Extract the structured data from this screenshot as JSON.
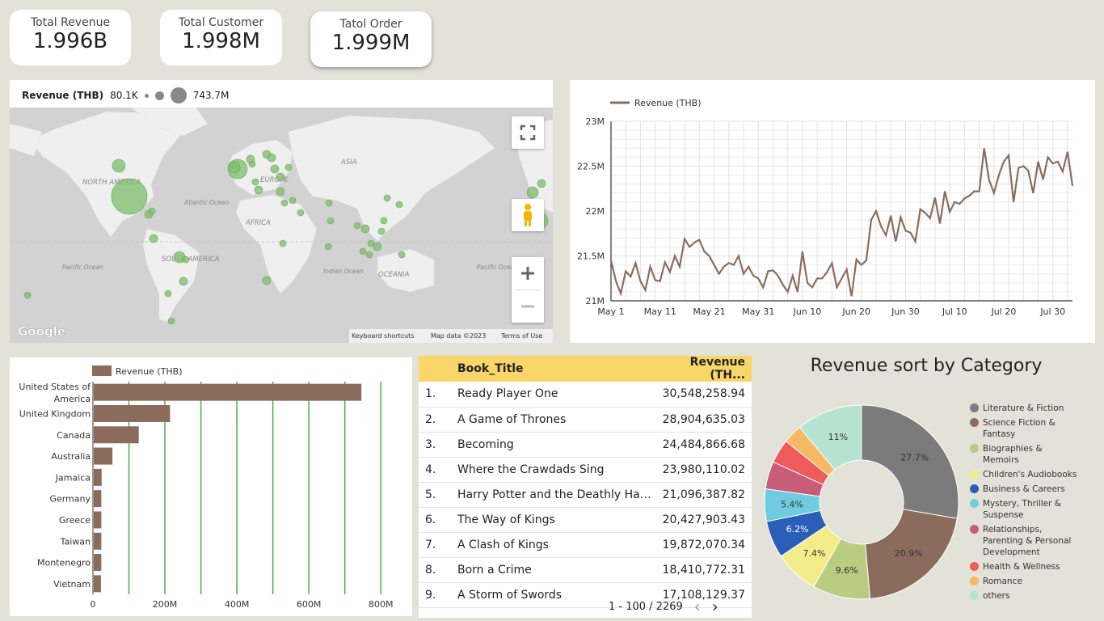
{
  "kpis": [
    {
      "label": "Total Revenue",
      "value": "1.996B"
    },
    {
      "label": "Total Customer",
      "value": "1.998M"
    },
    {
      "label": "Tatol Order",
      "value": "1.999M"
    }
  ],
  "map": {
    "legend_label": "Revenue (THB)",
    "legend_min": "80.1K",
    "legend_max": "743.7M",
    "continents": [
      "NORTH AMERICA",
      "EUROPE",
      "ASIA",
      "AFRICA",
      "SOUTH AMERICA",
      "OCEANIA"
    ],
    "oceans": [
      "Atlantic Ocean",
      "Pacific Ocean",
      "Indian Ocean",
      "Pacific Ocean"
    ],
    "attribution": {
      "logo": "Google",
      "shortcuts": "Keyboard shortcuts",
      "data": "Map data ©2023",
      "terms": "Terms of Use"
    },
    "colors": {
      "water": "#d2d2d2",
      "land": "#eeeeee",
      "bubble": "#7bbf6a"
    }
  },
  "line_chart": {
    "chart_data": {
      "type": "line",
      "series": [
        {
          "name": "Revenue (THB)",
          "color": "#8b6c5c"
        }
      ],
      "x_ticks": [
        "May 1",
        "May 11",
        "May 21",
        "May 31",
        "Jun 10",
        "Jun 20",
        "Jun 30",
        "Jul 10",
        "Jul 20",
        "Jul 30"
      ],
      "y_ticks": [
        "23M",
        "22.5M",
        "22M",
        "21.5M",
        "21M"
      ],
      "ylim": [
        21000000,
        23000000
      ],
      "x_start": "2023-05-01",
      "values": [
        21.45,
        21.22,
        21.08,
        21.33,
        21.27,
        21.42,
        21.22,
        21.12,
        21.38,
        21.23,
        21.22,
        21.43,
        21.32,
        21.5,
        21.38,
        21.69,
        21.6,
        21.65,
        21.68,
        21.55,
        21.5,
        21.4,
        21.3,
        21.38,
        21.42,
        21.4,
        21.5,
        21.3,
        21.38,
        21.28,
        21.25,
        21.15,
        21.33,
        21.34,
        21.28,
        21.18,
        21.1,
        21.28,
        21.1,
        21.55,
        21.2,
        21.15,
        21.25,
        21.25,
        21.32,
        21.42,
        21.15,
        21.25,
        21.35,
        21.05,
        21.46,
        21.4,
        21.45,
        21.9,
        22.0,
        21.83,
        21.73,
        21.95,
        21.66,
        21.93,
        21.78,
        21.76,
        21.66,
        22.02,
        21.98,
        21.92,
        22.15,
        21.86,
        22.22,
        21.99,
        22.1,
        22.08,
        22.14,
        22.17,
        22.22,
        22.22,
        22.7,
        22.35,
        22.2,
        22.4,
        22.55,
        22.62,
        22.1,
        22.48,
        22.5,
        22.45,
        22.2,
        22.55,
        22.35,
        22.6,
        22.53,
        22.55,
        22.44,
        22.66,
        22.28
      ]
    }
  },
  "bar_chart": {
    "chart_data": {
      "type": "bar",
      "orientation": "horizontal",
      "series": [
        {
          "name": "Revenue (THB)",
          "color": "#8b6c5c"
        }
      ],
      "categories": [
        "United States of America",
        "United Kingdom",
        "Canada",
        "Australia",
        "Jamaica",
        "Germany",
        "Greece",
        "Taiwan",
        "Montenegro",
        "Vietnam"
      ],
      "values": [
        743700000,
        212000000,
        125000000,
        52000000,
        22000000,
        21000000,
        21000000,
        21000000,
        21000000,
        20000000
      ],
      "x_ticks": [
        "0",
        "200M",
        "400M",
        "600M",
        "800M"
      ],
      "xlim": [
        0,
        800000000
      ],
      "grid_color": "#4caf50"
    }
  },
  "table": {
    "headers": {
      "title": "Book_Title",
      "revenue": "Revenue (TH..."
    },
    "rows": [
      {
        "n": "1.",
        "title": "Ready Player One",
        "rev": "30,548,258.94"
      },
      {
        "n": "2.",
        "title": "A Game of Thrones",
        "rev": "28,904,635.03"
      },
      {
        "n": "3.",
        "title": "Becoming",
        "rev": "24,484,866.68"
      },
      {
        "n": "4.",
        "title": "Where the Crawdads Sing",
        "rev": "23,980,110.02"
      },
      {
        "n": "5.",
        "title": "Harry Potter and the Deathly Hallo...",
        "rev": "21,096,387.82"
      },
      {
        "n": "6.",
        "title": "The Way of Kings",
        "rev": "20,427,903.43"
      },
      {
        "n": "7.",
        "title": "A Clash of Kings",
        "rev": "19,872,070.34"
      },
      {
        "n": "8.",
        "title": "Born a Crime",
        "rev": "18,410,772.31"
      },
      {
        "n": "9.",
        "title": "A Storm of Swords",
        "rev": "17,108,129.37"
      }
    ],
    "pager": "1 - 100 / 2269",
    "prev_icon": "‹",
    "next_icon": "›"
  },
  "pie": {
    "title": "Revenue sort by Category",
    "chart_data": {
      "type": "pie",
      "donut": true,
      "slices": [
        {
          "label": "Literature & Fiction",
          "value": 27.7,
          "color": "#7b7b7b"
        },
        {
          "label": "Science Fiction & Fantasy",
          "value": 20.9,
          "color": "#8b6c5c"
        },
        {
          "label": "Biographies & Memoirs",
          "value": 9.6,
          "color": "#b8cc82"
        },
        {
          "label": "Children's Audiobooks",
          "value": 7.4,
          "color": "#f4ec8a"
        },
        {
          "label": "Business & Careers",
          "value": 6.2,
          "color": "#2a5fb8"
        },
        {
          "label": "Mystery, Thriller & Suspense",
          "value": 5.4,
          "color": "#6fcce0"
        },
        {
          "label": "Relationships, Parenting & Personal Development",
          "value": 4.6,
          "color": "#c95c78"
        },
        {
          "label": "Health & Wellness",
          "value": 4.0,
          "color": "#ef5a5a"
        },
        {
          "label": "Romance",
          "value": 3.2,
          "color": "#f5b961"
        },
        {
          "label": "others",
          "value": 11.0,
          "color": "#b6e2d1"
        }
      ],
      "shown_labels": [
        "27.7%",
        "20.9%",
        "9.6%",
        "7.4%",
        "6.2%",
        "5.4%",
        "",
        "",
        "",
        "11%"
      ]
    }
  }
}
